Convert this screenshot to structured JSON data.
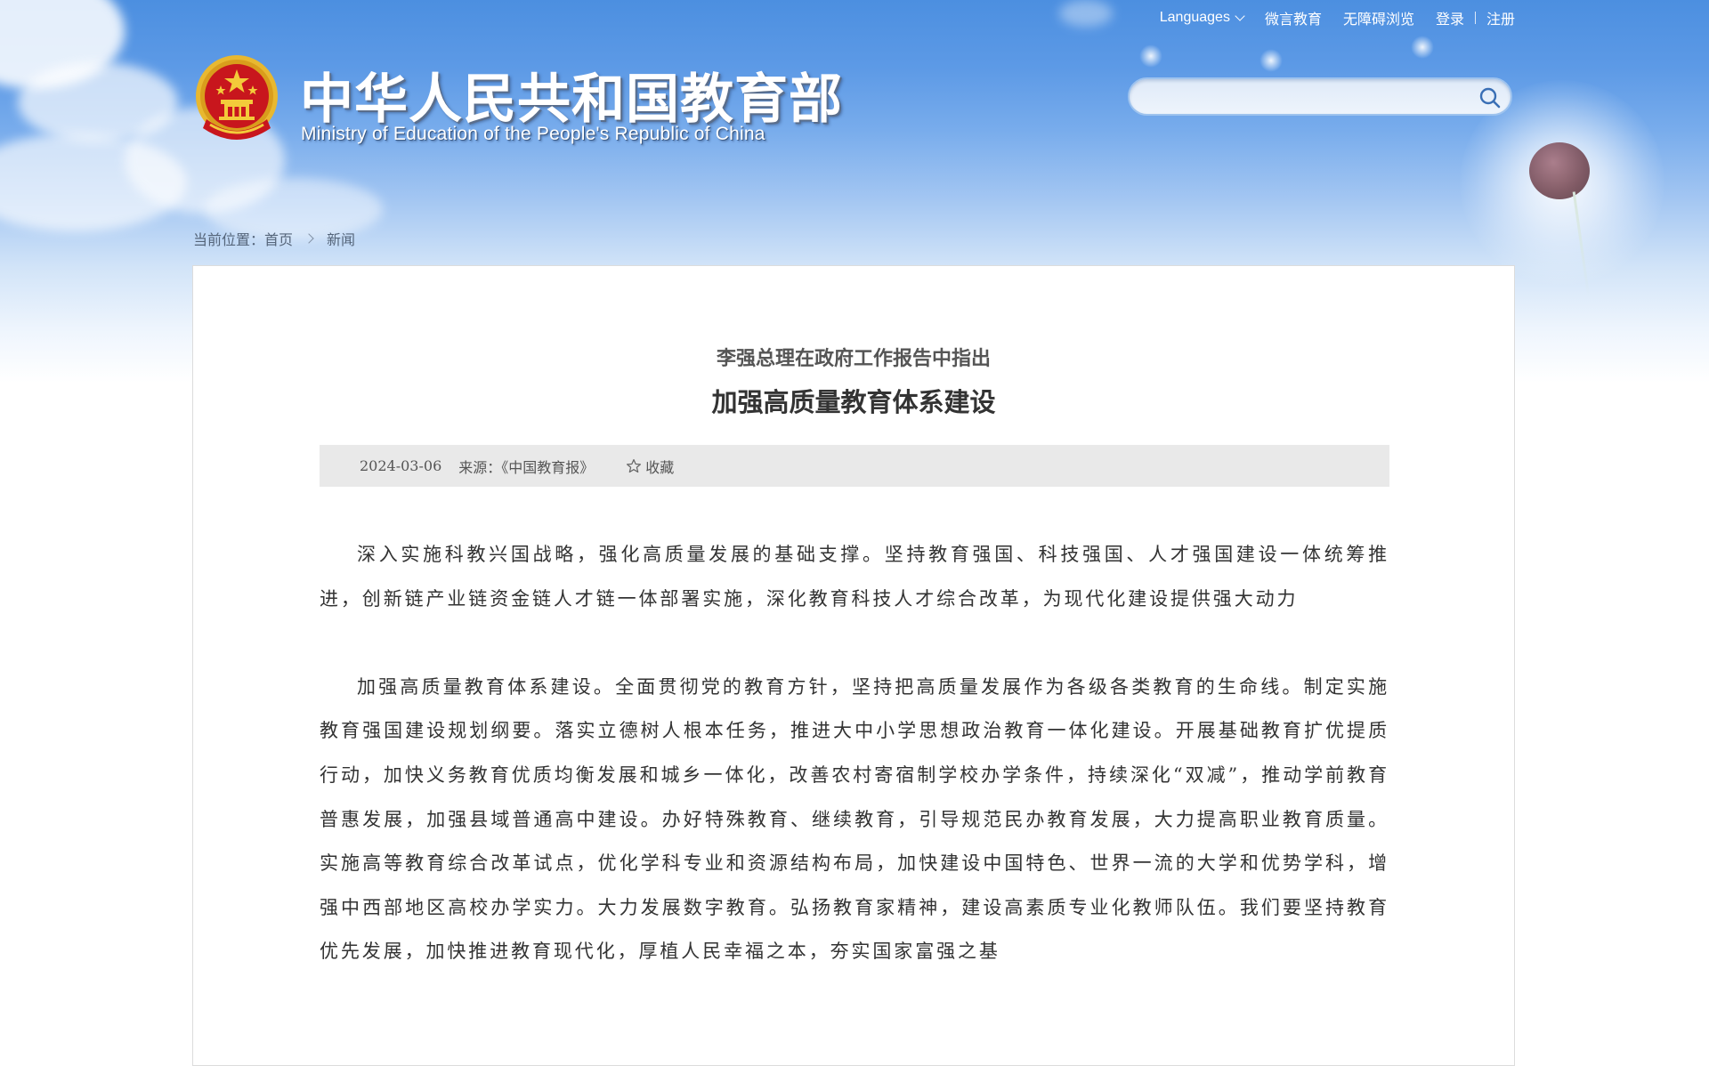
{
  "header": {
    "title_cn": "中华人民共和国教育部",
    "title_en": "Ministry of Education of the People's Republic of China",
    "top_links": {
      "languages": "Languages",
      "weiyan": "微言教育",
      "accessible": "无障碍浏览",
      "login": "登录",
      "register": "注册"
    },
    "search": {
      "placeholder": "",
      "value": ""
    }
  },
  "breadcrumb": {
    "prefix": "当前位置：",
    "home": "首页",
    "current": "新闻"
  },
  "article": {
    "subtitle": "李强总理在政府工作报告中指出",
    "title": "加强高质量教育体系建设",
    "date": "2024-03-06",
    "source": "来源：《中国教育报》",
    "favorite_label": "收藏",
    "paragraphs": [
      "深入实施科教兴国战略，强化高质量发展的基础支撑。坚持教育强国、科技强国、人才强国建设一体统筹推进，创新链产业链资金链人才链一体部署实施，深化教育科技人才综合改革，为现代化建设提供强大动力",
      "加强高质量教育体系建设。全面贯彻党的教育方针，坚持把高质量发展作为各级各类教育的生命线。制定实施教育强国建设规划纲要。落实立德树人根本任务，推进大中小学思想政治教育一体化建设。开展基础教育扩优提质行动，加快义务教育优质均衡发展和城乡一体化，改善农村寄宿制学校办学条件，持续深化“双减”，推动学前教育普惠发展，加强县域普通高中建设。办好特殊教育、继续教育，引导规范民办教育发展，大力提高职业教育质量。实施高等教育综合改革试点，优化学科专业和资源结构布局，加快建设中国特色、世界一流的大学和优势学科，增强中西部地区高校办学实力。大力发展数字教育。弘扬教育家精神，建设高素质专业化教师队伍。我们要坚持教育优先发展，加快推进教育现代化，厚植人民幸福之本，夯实国家富强之基"
    ]
  },
  "icons": {
    "emblem": "national-emblem-icon",
    "search": "search-icon",
    "favorite": "star-icon",
    "languages_dropdown": "chevron-down-icon"
  },
  "colors": {
    "sky_top": "#4c8fe0",
    "meta_bar": "#e9e9e9",
    "emblem_red": "#c8161d",
    "emblem_gold": "#e8b830"
  }
}
